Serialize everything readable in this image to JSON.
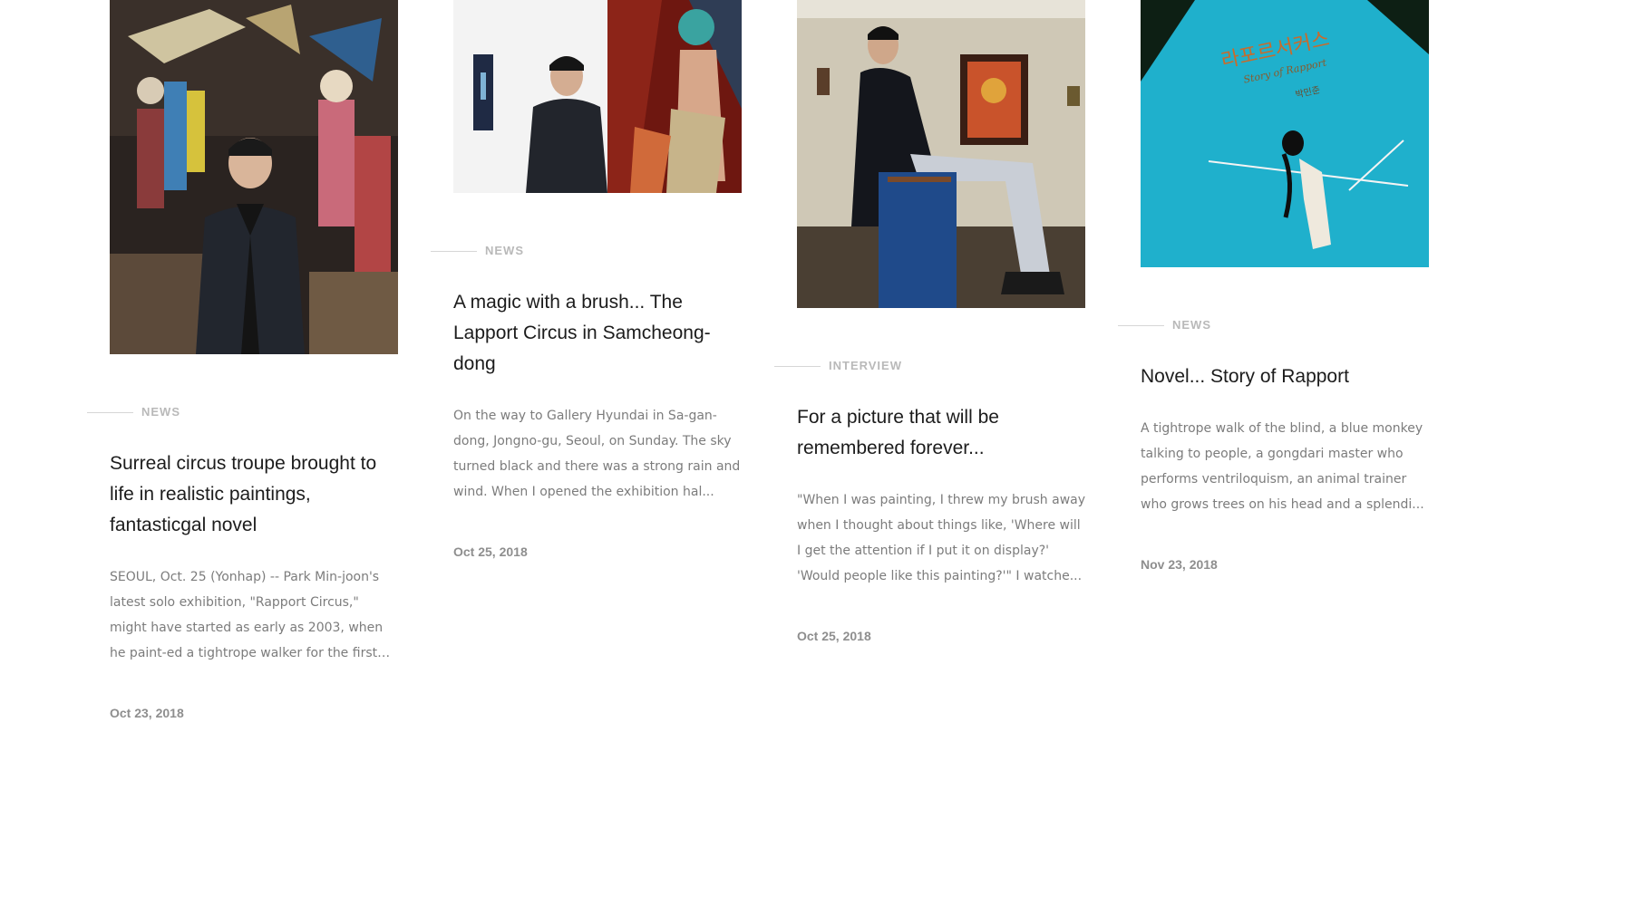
{
  "cards": [
    {
      "category": "NEWS",
      "title": "Surreal circus troupe brought to life in realistic paintings, fantasticgal novel",
      "excerpt": "SEOUL, Oct. 25 (Yonhap) -- Park Min-joon's latest solo exhibition, \"Rapport Circus,\" might have started as early as 2003, when he paint-ed a tightrope walker for the first time --...",
      "date": "Oct 23, 2018"
    },
    {
      "category": "NEWS",
      "title": "A magic with a brush... The Lapport Circus in Samcheong-dong",
      "excerpt": "On the way to Gallery Hyundai in Sa-gan-dong, Jongno-gu, Seoul, on Sunday. The sky turned black and there was a strong rain and wind. When I opened the exhibition hal...",
      "date": "Oct 25, 2018"
    },
    {
      "category": "INTERVIEW",
      "title": "For a picture that will be remembered forever...",
      "excerpt": "\"When I was painting, I threw my brush away when I thought about things like, 'Where will I get the attention if I put it on display?' 'Would people like this painting?'\" I watche...",
      "date": "Oct 25, 2018"
    },
    {
      "category": "NEWS",
      "title": "Novel... Story of Rapport",
      "excerpt": "A tightrope walk of the blind, a blue monkey talking to people, a gongdari master who performs ventriloquism, an animal trainer who grows trees on his head and a splendi...",
      "date": "Nov 23, 2018"
    }
  ],
  "book_cover": {
    "korean_title": "라포르서커스",
    "subtitle": "Story of Rapport",
    "author": "박민준"
  },
  "colors": {
    "title": "#1c1c1c",
    "excerpt": "#7c7c7c",
    "category": "#b9b9b9",
    "date": "#8e8e8e",
    "book_cover": "#21b2cf"
  }
}
